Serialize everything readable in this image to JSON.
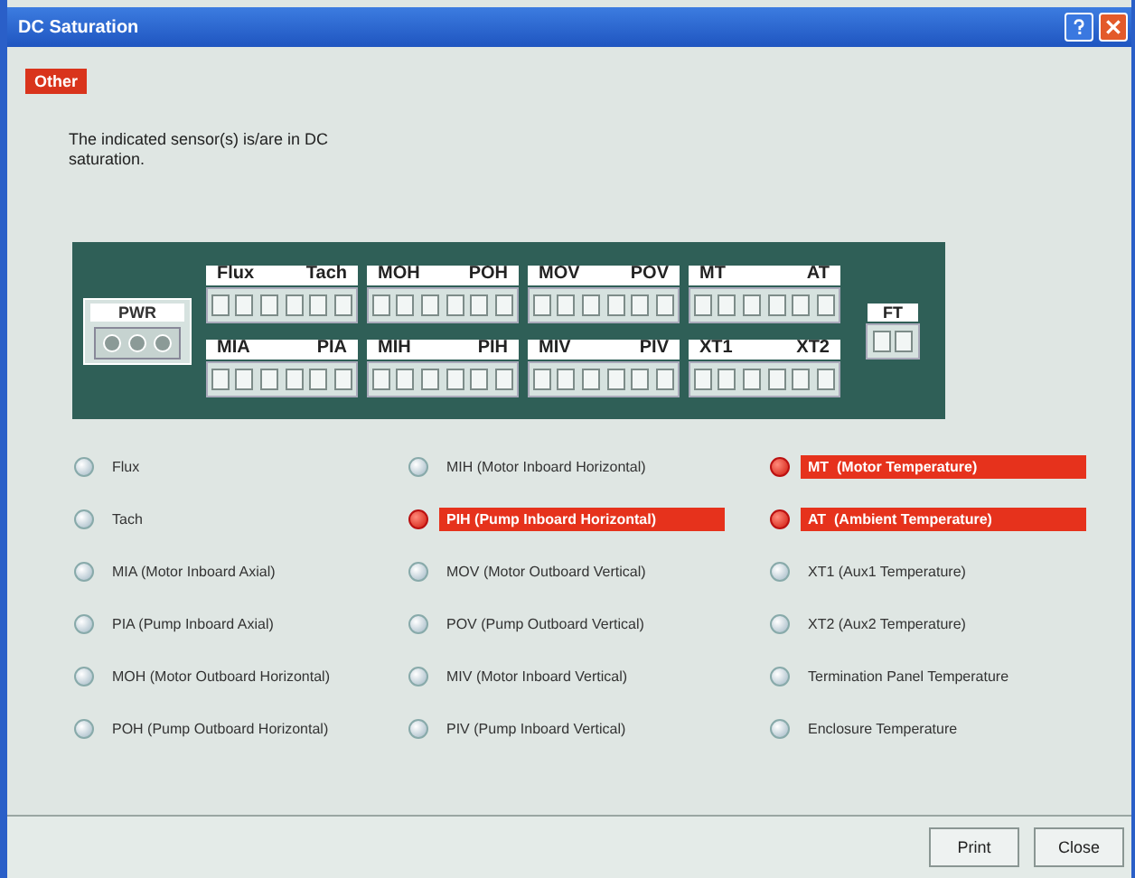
{
  "window": {
    "title": "DC Saturation"
  },
  "tabs": [
    {
      "label": "Other",
      "selected": true
    }
  ],
  "message": "The indicated sensor(s) is/are in DC saturation.",
  "board": {
    "power": {
      "label": "PWR"
    },
    "connectors": [
      {
        "labels": [
          "Flux",
          "Tach"
        ]
      },
      {
        "labels": [
          "MOH",
          "POH"
        ]
      },
      {
        "labels": [
          "MOV",
          "POV"
        ]
      },
      {
        "labels": [
          "MT",
          "AT"
        ]
      },
      {
        "labels": [
          "MIA",
          "PIA"
        ]
      },
      {
        "labels": [
          "MIH",
          "PIH"
        ]
      },
      {
        "labels": [
          "MIV",
          "PIV"
        ]
      },
      {
        "labels": [
          "XT1",
          "XT2"
        ]
      }
    ],
    "small": {
      "label": "FT"
    }
  },
  "sensor_columns": [
    [
      {
        "label": "Flux",
        "saturated": false
      },
      {
        "label": "Tach",
        "saturated": false
      },
      {
        "label": "MIA (Motor Inboard Axial)",
        "saturated": false
      },
      {
        "label": "PIA (Pump Inboard Axial)",
        "saturated": false
      },
      {
        "label": "MOH (Motor Outboard Horizontal)",
        "saturated": false
      },
      {
        "label": "POH (Pump Outboard Horizontal)",
        "saturated": false
      }
    ],
    [
      {
        "label": "MIH (Motor Inboard Horizontal)",
        "saturated": false
      },
      {
        "label": "PIH (Pump Inboard Horizontal)",
        "saturated": true
      },
      {
        "label": "MOV (Motor Outboard Vertical)",
        "saturated": false
      },
      {
        "label": "POV (Pump Outboard Vertical)",
        "saturated": false
      },
      {
        "label": "MIV (Motor Inboard Vertical)",
        "saturated": false
      },
      {
        "label": "PIV (Pump Inboard Vertical)",
        "saturated": false
      }
    ],
    [
      {
        "label": "MT  (Motor Temperature)",
        "saturated": true
      },
      {
        "label": "AT  (Ambient Temperature)",
        "saturated": true
      },
      {
        "label": "XT1 (Aux1 Temperature)",
        "saturated": false
      },
      {
        "label": "XT2 (Aux2 Temperature)",
        "saturated": false
      },
      {
        "label": "Termination Panel Temperature",
        "saturated": false
      },
      {
        "label": "Enclosure Temperature",
        "saturated": false
      }
    ]
  ],
  "buttons": [
    "Print",
    "Close"
  ]
}
